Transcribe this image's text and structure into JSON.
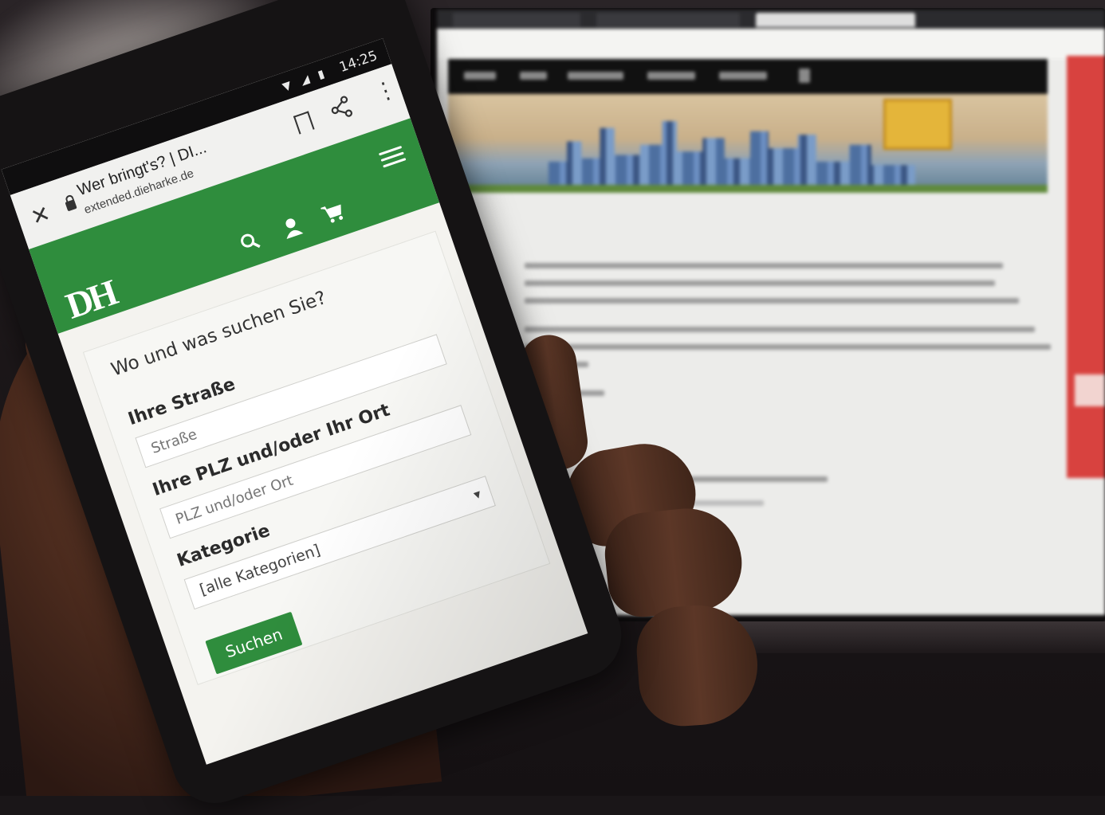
{
  "phone": {
    "status_time": "14:25",
    "browser": {
      "tab_title": "Wer bringt's? | DI...",
      "url": "extended.dieharke.de",
      "icons": [
        "close-icon",
        "lock-icon",
        "bookmark-icon",
        "share-icon",
        "more-vert-icon"
      ]
    },
    "site": {
      "logo": "DH",
      "brand_color": "#2f8d3d",
      "header_icons": [
        "search-icon",
        "user-icon",
        "cart-icon",
        "menu-icon"
      ]
    },
    "form": {
      "heading": "Wo und was suchen Sie?",
      "street_label": "Ihre Straße",
      "street_placeholder": "Straße",
      "zip_label": "Ihre PLZ und/oder Ihr Ort",
      "zip_placeholder": "PLZ und/oder Ort",
      "category_label": "Kategorie",
      "category_selected": "[alle Kategorien]",
      "submit_label": "Suchen"
    }
  }
}
